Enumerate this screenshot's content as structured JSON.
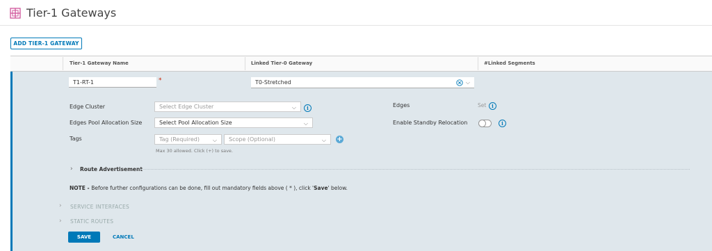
{
  "header": {
    "title": "Tier-1 Gateways",
    "icon": "gateway-icon"
  },
  "toolbar": {
    "add_label": "ADD TIER-1 GATEWAY"
  },
  "grid": {
    "columns": [
      "Tier-1 Gateway Name",
      "Linked Tier-0 Gateway",
      "#Linked Segments"
    ]
  },
  "form": {
    "name_value": "T1-RT-1",
    "required_marker": "*",
    "tier0_value": "T0-Stretched",
    "edge_cluster": {
      "label": "Edge Cluster",
      "placeholder": "Select Edge Cluster"
    },
    "pool_size": {
      "label": "Edges Pool Allocation Size",
      "placeholder": "Select Pool Allocation Size"
    },
    "edges": {
      "label": "Edges",
      "value": "Set"
    },
    "standby": {
      "label": "Enable Standby Relocation"
    },
    "tags": {
      "label": "Tags",
      "tag_placeholder": "Tag (Required)",
      "scope_placeholder": "Scope (Optional)",
      "hint": "Max 30 allowed. Click (+) to save."
    },
    "route_advertisement": "Route Advertisement",
    "note_prefix": "NOTE - ",
    "note_text": "Before further configurations can be done, fill out mandatory fields above ( * ), click '",
    "note_bold": "Save",
    "note_suffix": "' below.",
    "sections": [
      "SERVICE INTERFACES",
      "STATIC ROUTES"
    ],
    "save_label": "SAVE",
    "cancel_label": "CANCEL"
  },
  "colors": {
    "accent": "#0079b8",
    "row_bg": "#dfe7ec",
    "required": "#c92100"
  }
}
